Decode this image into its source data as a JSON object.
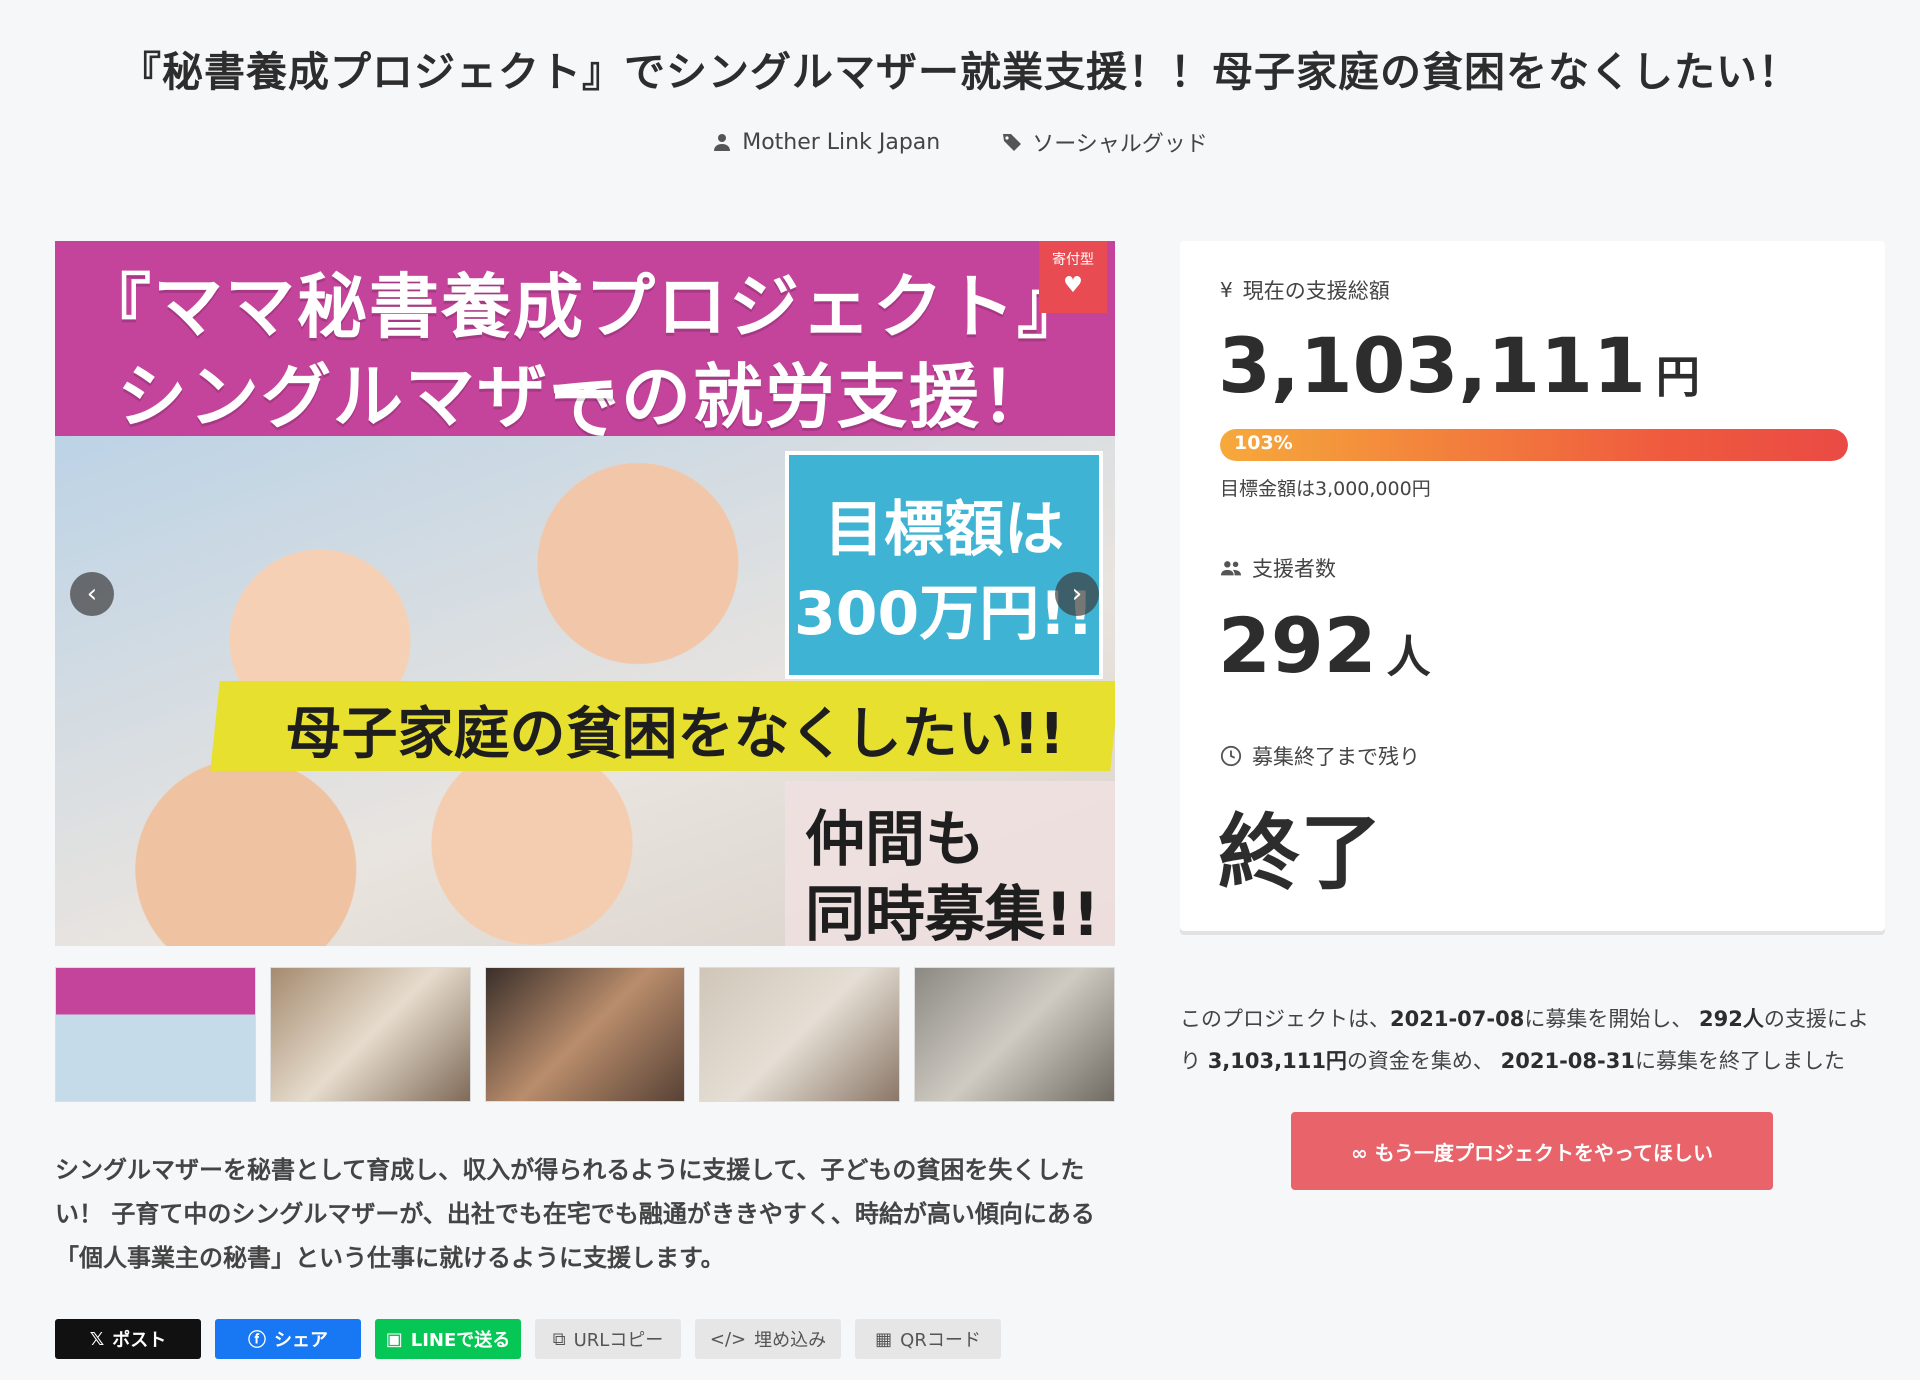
{
  "page": {
    "title": "『秘書養成プロジェクト』でシングルマザー就業支援！！母子家庭の貧困をなくしたい！",
    "owner": "Mother Link Japan",
    "category": "ソーシャルグッド"
  },
  "hero": {
    "headline_line1": "『ママ秘書養成プロジェクト』で",
    "headline_line2": "シングルマザーの就労支援！",
    "goal_line1": "目標額は",
    "goal_line2": "300万円!!",
    "banner": "母子家庭の貧困をなくしたい!!",
    "recruit_line1": "仲間も",
    "recruit_line2": "同時募集!!",
    "badge": "寄付型",
    "prev_icon": "chevron-left-icon",
    "next_icon": "chevron-right-icon"
  },
  "description": "シングルマザーを秘書として育成し、収入が得られるように支援して、子どもの貧困を失くしたい！ 子育て中のシングルマザーが、出社でも在宅でも融通がききやすく、時給が高い傾向にある「個人事業主の秘書」という仕事に就けるように支援します。",
  "share": {
    "x": "ポスト",
    "facebook": "シェア",
    "line": "LINEで送る",
    "url_copy": "URLコピー",
    "embed": "埋め込み",
    "qr": "QRコード"
  },
  "stats": {
    "total_label": "現在の支援総額",
    "total_amount": "3,103,111",
    "currency_unit": "円",
    "progress_percent": 103,
    "progress_label": "103%",
    "goal_text": "目標金額は3,000,000円",
    "backers_label": "支援者数",
    "backers_count": "292",
    "backers_unit": "人",
    "remaining_label": "募集終了まで残り",
    "remaining_value": "終了"
  },
  "summary": {
    "prefix": "このプロジェクトは、",
    "start_date": "2021-07-08",
    "part2": "に募集を開始し、",
    "backers": "292人",
    "part3": "の支援により",
    "amount": "3,103,111円",
    "part4": "の資金を集め、",
    "end_date": "2021-08-31",
    "part5": "に募集を終了しました"
  },
  "again_button": "∞ もう一度プロジェクトをやってほしい",
  "colors": {
    "accent": "#e8646a",
    "progress_start": "#f6a93b",
    "progress_end": "#ea4a44",
    "hero_pink": "#c4449b"
  }
}
